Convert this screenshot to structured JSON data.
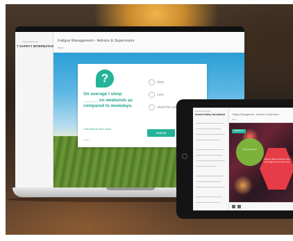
{
  "laptop": {
    "sidebar_logo": "T SAFETY INTERNATIONAL",
    "sidebar_logo_sub": "Seeing Machines",
    "app_title": "Fatigue Management - Admins & Supervisors",
    "menu_label": "Menu",
    "quiz": {
      "badge": "?",
      "question": "On average I sleep ______ on weekends as compared to weekdays.",
      "hint_link": "Click submit when done",
      "counter": "1 of 7",
      "options": [
        "More",
        "Less",
        "About the same"
      ],
      "submit_label": "Submit"
    }
  },
  "tablet": {
    "logo": "Sentient Safety International",
    "logo_sub": "Fatigue Management",
    "app_title": "Fatigue Management - Admins & Supervisors",
    "menu_label": "Menu",
    "feedback_label": "FEEDBACK",
    "bubble_text": "Did you know?",
    "hex_text": "Fatigue affects reaction time and judgement on the road."
  },
  "colors": {
    "accent": "#25b399",
    "alert": "#e63c47",
    "bubble": "#7dbb3a"
  }
}
